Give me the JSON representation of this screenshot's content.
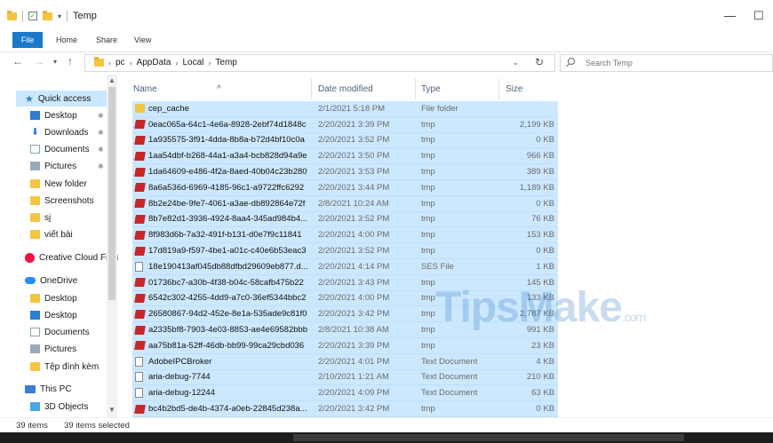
{
  "window": {
    "title": "Temp",
    "minimize_glyph": "—",
    "maximize_glyph": "☐"
  },
  "ribbon": {
    "tabs": [
      "File",
      "Home",
      "Share",
      "View"
    ]
  },
  "address": {
    "crumbs": [
      "pc",
      "AppData",
      "Local",
      "Temp"
    ],
    "separator": "›"
  },
  "search": {
    "placeholder": "Search Temp"
  },
  "nav_pane": {
    "items": [
      {
        "label": "Quick access",
        "icon": "star-icon"
      },
      {
        "label": "Desktop",
        "icon": "desktop-icon",
        "pinned": true
      },
      {
        "label": "Downloads",
        "icon": "download-icon",
        "pinned": true
      },
      {
        "label": "Documents",
        "icon": "documents-icon",
        "pinned": true
      },
      {
        "label": "Pictures",
        "icon": "pictures-icon",
        "pinned": true
      },
      {
        "label": "New folder",
        "icon": "folder-icon"
      },
      {
        "label": "Screenshots",
        "icon": "folder-icon"
      },
      {
        "label": "sj",
        "icon": "folder-icon"
      },
      {
        "label": "viết bài",
        "icon": "folder-icon"
      },
      {
        "label": "Creative Cloud Files",
        "icon": "creative-cloud-icon"
      },
      {
        "label": "OneDrive",
        "icon": "onedrive-icon"
      },
      {
        "label": "Desktop",
        "icon": "folder-icon"
      },
      {
        "label": "Desktop",
        "icon": "desktop-icon"
      },
      {
        "label": "Documents",
        "icon": "documents-icon"
      },
      {
        "label": "Pictures",
        "icon": "pictures-icon"
      },
      {
        "label": "Tệp đính kèm",
        "icon": "folder-icon"
      },
      {
        "label": "This PC",
        "icon": "pc-icon"
      },
      {
        "label": "3D Objects",
        "icon": "3d-objects-icon"
      }
    ]
  },
  "columns": {
    "name": "Name",
    "date": "Date modified",
    "type": "Type",
    "size": "Size"
  },
  "files": [
    {
      "name": "cep_cache",
      "date": "2/1/2021 5:18 PM",
      "type": "File folder",
      "size": "",
      "icon": "folder"
    },
    {
      "name": "0eac065a-64c1-4e6a-8928-2ebf74d1848c",
      "date": "2/20/2021 3:39 PM",
      "type": "tmp",
      "size": "2,199 KB",
      "icon": "tmp"
    },
    {
      "name": "1a935575-3f91-4dda-8b8a-b72d4bf10c0a",
      "date": "2/20/2021 3:52 PM",
      "type": "tmp",
      "size": "0 KB",
      "icon": "tmp"
    },
    {
      "name": "1aa54dbf-b268-44a1-a3a4-bcb828d94a9e",
      "date": "2/20/2021 3:50 PM",
      "type": "tmp",
      "size": "966 KB",
      "icon": "tmp"
    },
    {
      "name": "1da64609-e486-4f2a-8aed-40b04c23b280",
      "date": "2/20/2021 3:53 PM",
      "type": "tmp",
      "size": "389 KB",
      "icon": "tmp"
    },
    {
      "name": "8a6a536d-6969-4185-96c1-a9722ffc6292",
      "date": "2/20/2021 3:44 PM",
      "type": "tmp",
      "size": "1,189 KB",
      "icon": "tmp"
    },
    {
      "name": "8b2e24be-9fe7-4061-a3ae-db892864e72f",
      "date": "2/8/2021 10:24 AM",
      "type": "tmp",
      "size": "0 KB",
      "icon": "tmp"
    },
    {
      "name": "8b7e82d1-3936-4924-8aa4-345ad984b4...",
      "date": "2/20/2021 3:52 PM",
      "type": "tmp",
      "size": "76 KB",
      "icon": "tmp"
    },
    {
      "name": "8f983d6b-7a32-491f-b131-d0e7f9c11841",
      "date": "2/20/2021 4:00 PM",
      "type": "tmp",
      "size": "153 KB",
      "icon": "tmp"
    },
    {
      "name": "17d819a9-f597-4be1-a01c-c40e6b53eac3",
      "date": "2/20/2021 3:52 PM",
      "type": "tmp",
      "size": "0 KB",
      "icon": "tmp"
    },
    {
      "name": "18e190413af045db88dfbd29609eb877.d...",
      "date": "2/20/2021 4:14 PM",
      "type": "SES File",
      "size": "1 KB",
      "icon": "doc"
    },
    {
      "name": "01736bc7-a30b-4f38-b04c-58cafb475b22",
      "date": "2/20/2021 3:43 PM",
      "type": "tmp",
      "size": "145 KB",
      "icon": "tmp"
    },
    {
      "name": "6542c302-4255-4dd9-a7c0-36ef5344bbc2",
      "date": "2/20/2021 4:00 PM",
      "type": "tmp",
      "size": "133 KB",
      "icon": "tmp"
    },
    {
      "name": "26580867-94d2-452e-8e1a-535ade9c81f0",
      "date": "2/20/2021 3:42 PM",
      "type": "tmp",
      "size": "2,787 KB",
      "icon": "tmp"
    },
    {
      "name": "a2335bf8-7903-4e03-8853-ae4e69582bbb",
      "date": "2/8/2021 10:38 AM",
      "type": "tmp",
      "size": "991 KB",
      "icon": "tmp"
    },
    {
      "name": "aa75b81a-52ff-46db-bb99-99ca29cbd036",
      "date": "2/20/2021 3:39 PM",
      "type": "tmp",
      "size": "23 KB",
      "icon": "tmp"
    },
    {
      "name": "AdobeIPCBroker",
      "date": "2/20/2021 4:01 PM",
      "type": "Text Document",
      "size": "4 KB",
      "icon": "doc"
    },
    {
      "name": "aria-debug-7744",
      "date": "2/10/2021 1:21 AM",
      "type": "Text Document",
      "size": "210 KB",
      "icon": "doc"
    },
    {
      "name": "aria-debug-12244",
      "date": "2/20/2021 4:09 PM",
      "type": "Text Document",
      "size": "63 KB",
      "icon": "doc"
    },
    {
      "name": "bc4b2bd5-de4b-4374-a0eb-22845d238a...",
      "date": "2/20/2021 3:42 PM",
      "type": "tmp",
      "size": "0 KB",
      "icon": "tmp"
    }
  ],
  "watermark": {
    "main": "TipsMake",
    "suffix": ".com"
  },
  "status": {
    "count": "39 items",
    "selected": "39 items selected"
  }
}
